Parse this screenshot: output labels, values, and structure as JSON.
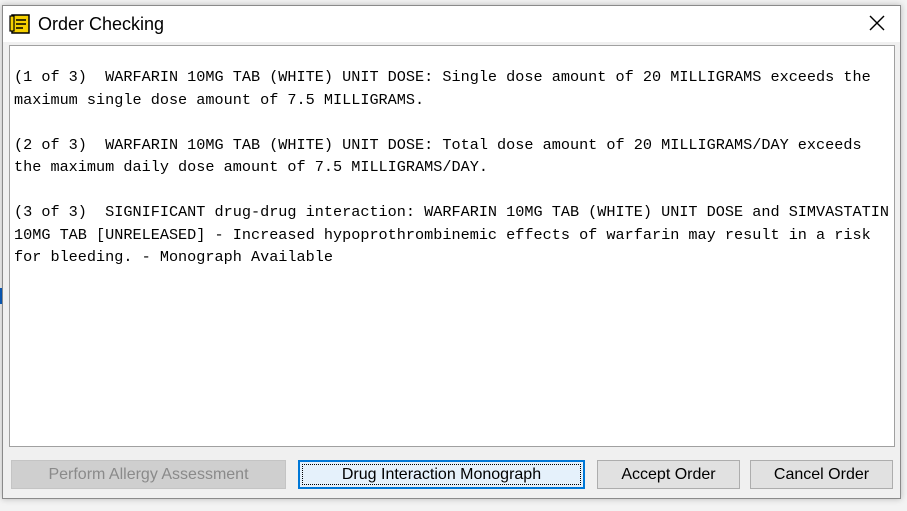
{
  "window": {
    "title": "Order Checking",
    "close_glyph": "✕"
  },
  "messages": [
    "(1 of 3)  WARFARIN 10MG TAB (WHITE) UNIT DOSE: Single dose amount of 20 MILLIGRAMS exceeds the maximum single dose amount of 7.5 MILLIGRAMS.",
    "(2 of 3)  WARFARIN 10MG TAB (WHITE) UNIT DOSE: Total dose amount of 20 MILLIGRAMS/DAY exceeds the maximum daily dose amount of 7.5 MILLIGRAMS/DAY.",
    "(3 of 3)  SIGNIFICANT drug-drug interaction: WARFARIN 10MG TAB (WHITE) UNIT DOSE and SIMVASTATIN 10MG TAB [UNRELEASED] - Increased hypoprothrombinemic effects of warfarin may result in a risk for bleeding. - Monograph Available"
  ],
  "buttons": {
    "perform_allergy": "Perform Allergy Assessment",
    "drug_monograph": "Drug Interaction Monograph",
    "accept_order": "Accept Order",
    "cancel_order": "Cancel Order"
  },
  "colors": {
    "focus_border": "#0078d7",
    "dialog_bg": "#f0f0f0",
    "icon_yellow": "#f5d000"
  }
}
